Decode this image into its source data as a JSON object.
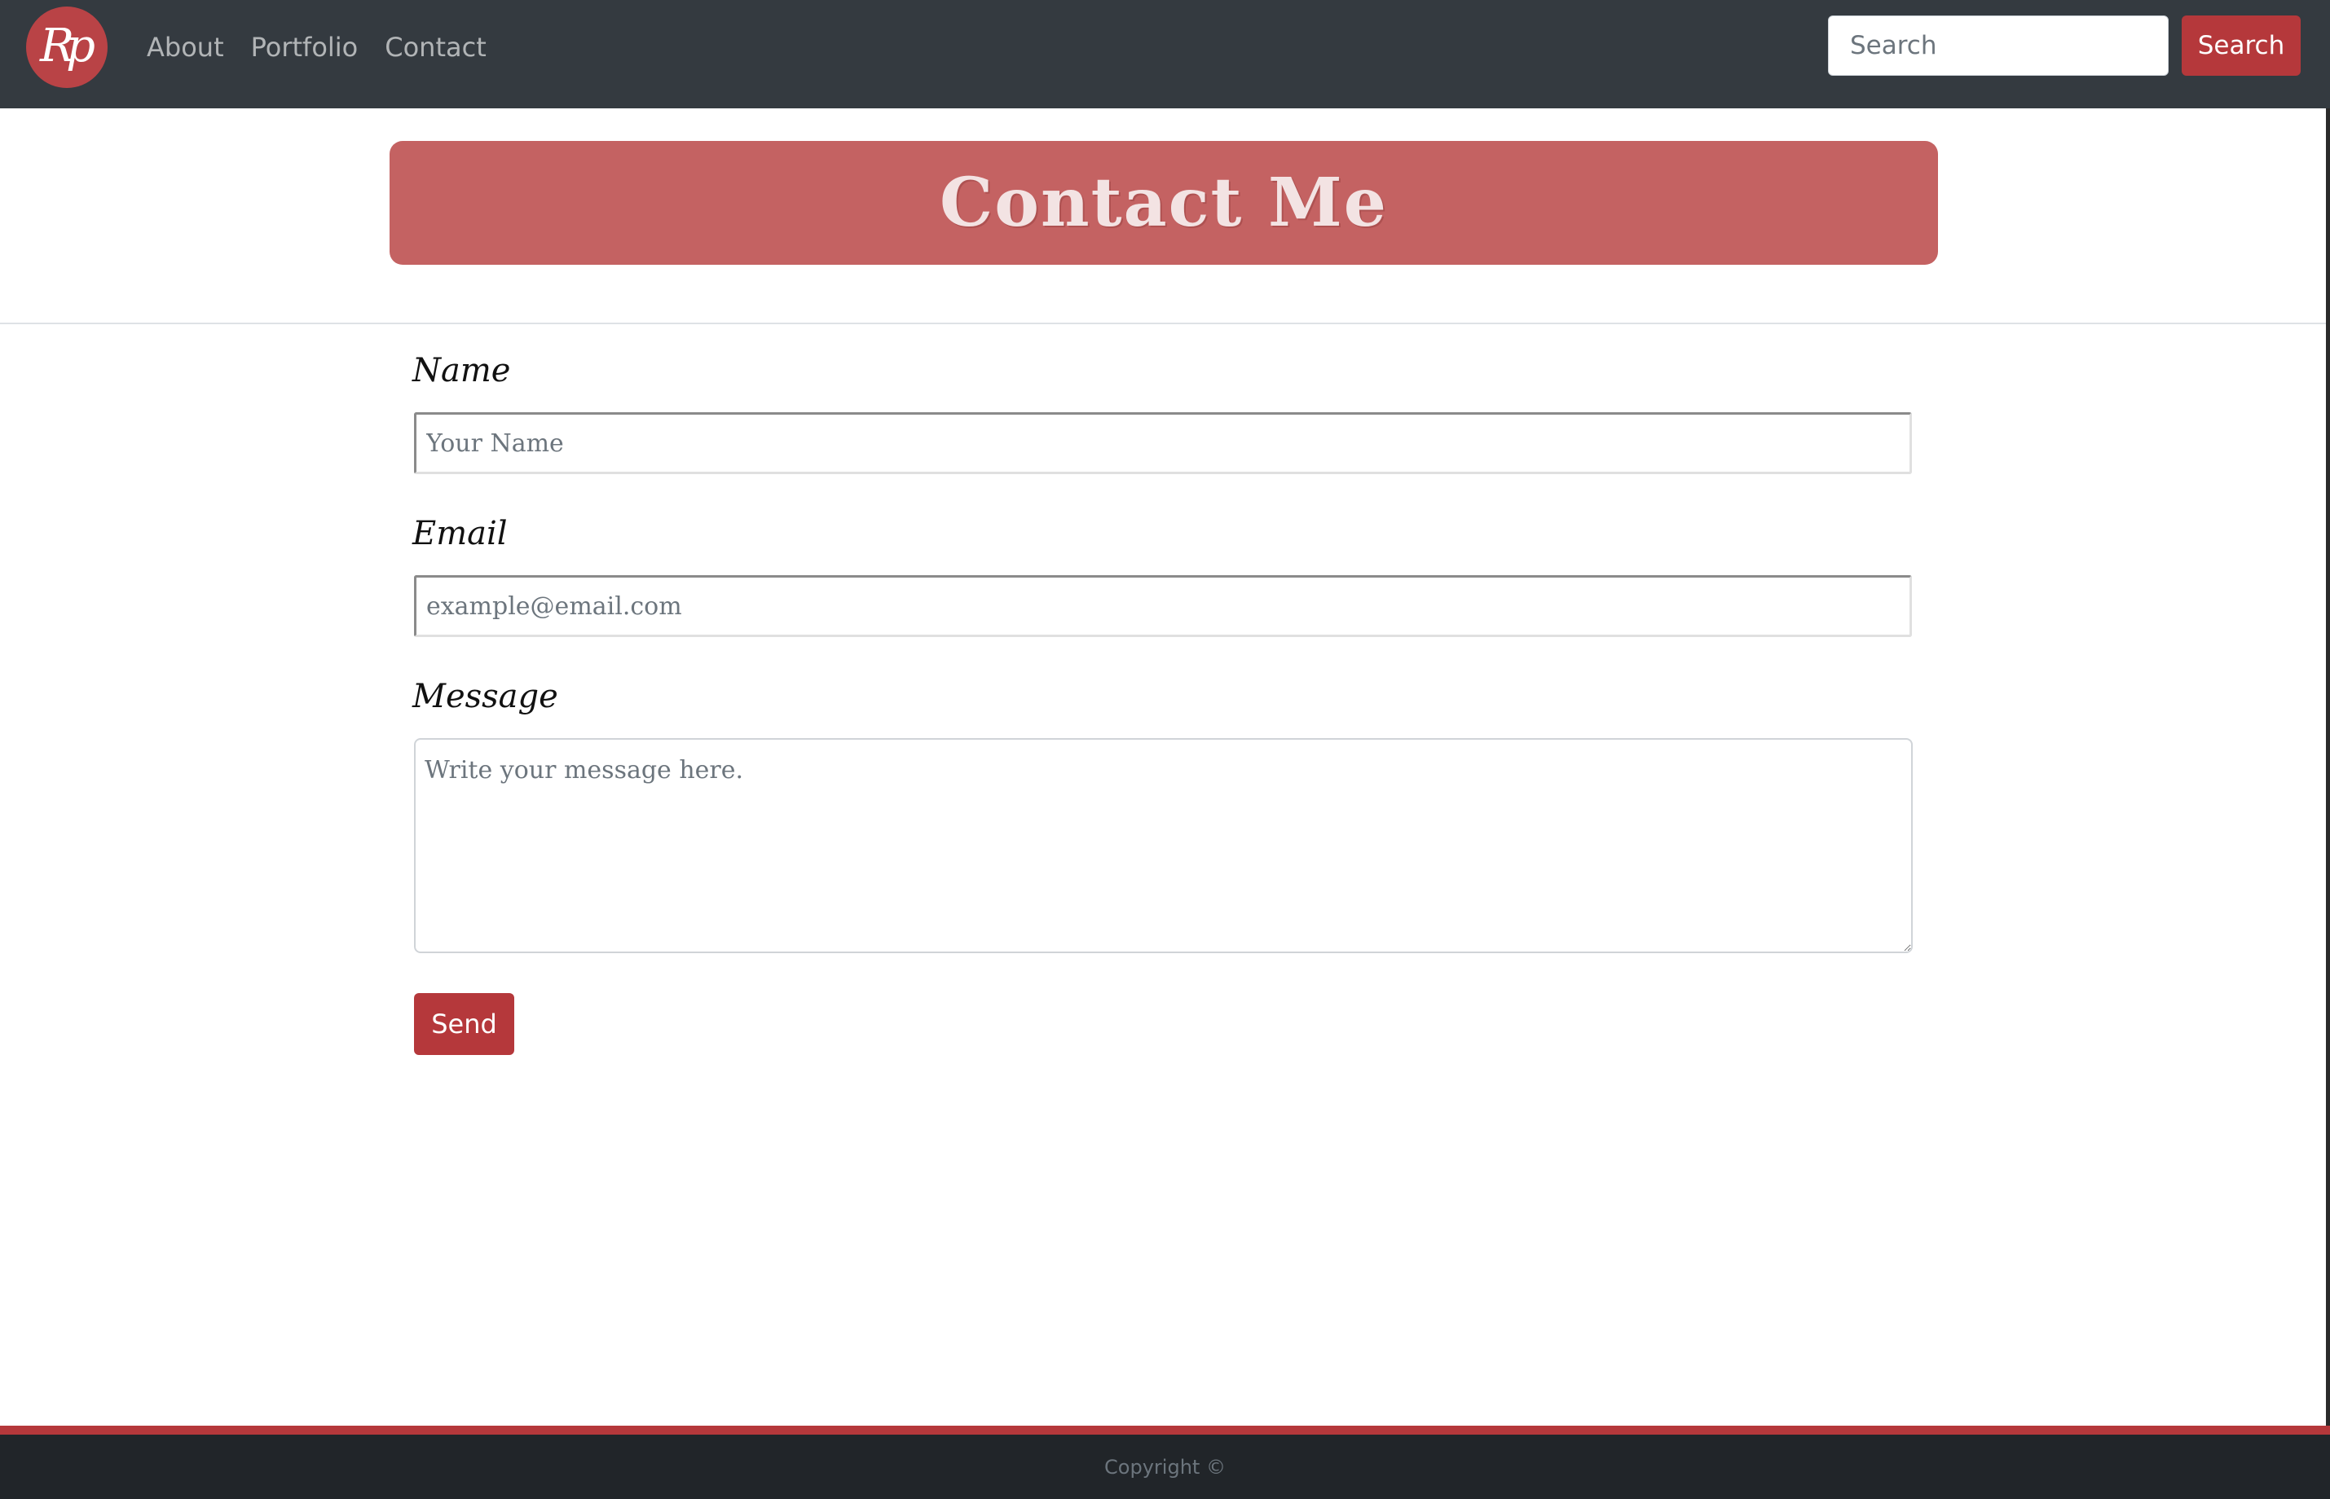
{
  "navbar": {
    "logo_text": "Rp",
    "links": [
      "About",
      "Portfolio",
      "Contact"
    ],
    "search": {
      "placeholder": "Search",
      "value": ""
    },
    "search_button_label": "Search"
  },
  "hero": {
    "title": "Contact Me"
  },
  "form": {
    "name": {
      "label": "Name",
      "placeholder": "Your Name"
    },
    "email": {
      "label": "Email",
      "placeholder": "example@email.com"
    },
    "message": {
      "label": "Message",
      "placeholder": "Write your message here."
    },
    "send_label": "Send"
  },
  "footer": {
    "copyright": "Copyright ©"
  },
  "colors": {
    "navbar_bg": "#343a40",
    "accent": "#b5383b",
    "hero_bg": "#c46262",
    "footer_bg": "#212529"
  }
}
